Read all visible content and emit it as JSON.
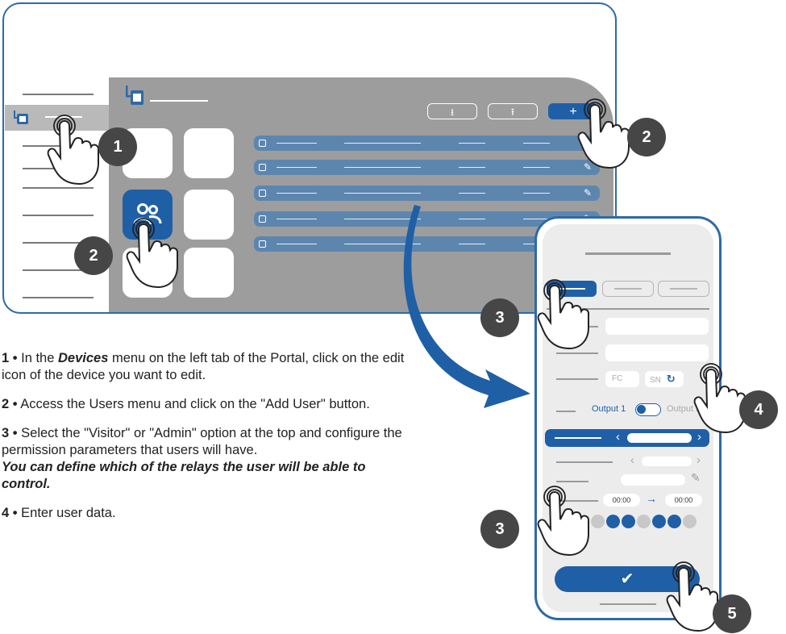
{
  "steps": {
    "s1_num": "1 •",
    "s1_a": " In the ",
    "s1_menu": "Devices",
    "s1_b": " menu on the left tab of the Portal, click on the edit icon of the device you want to edit.",
    "s2_num": "2 •",
    "s2_text": " Access the Users menu and click on the \"Add User\" button.",
    "s3_num": "3 •",
    "s3_text": " Select the \"Visitor\" or \"Admin\" option at the top and configure the permission parameters that users will have.",
    "s3_note": "You can define which of the relays the user will be able to control.",
    "s4_num": "4 •",
    "s4_text": " Enter user data."
  },
  "badges": {
    "b1": "1",
    "b2a": "2",
    "b2b": "2",
    "b3a": "3",
    "b3b": "3",
    "b4": "4",
    "b5": "5"
  },
  "phone": {
    "fc_label": "FC",
    "sn_label": "SN",
    "output1": "Output 1",
    "output2": "Output 2",
    "time_start": "00:00",
    "time_end": "00:00"
  },
  "icons": {
    "download": "download-icon",
    "upload": "upload-icon",
    "add": "plus-icon",
    "edit": "pencil-icon",
    "users": "users-icon",
    "refresh": "refresh-icon",
    "confirm": "check-icon",
    "hand": "pointing-hand-icon"
  },
  "colors": {
    "brand_blue": "#1f5fa6",
    "row_blue": "#5d86af",
    "panel_gray": "#9d9d9d",
    "badge_dark": "#464646"
  }
}
